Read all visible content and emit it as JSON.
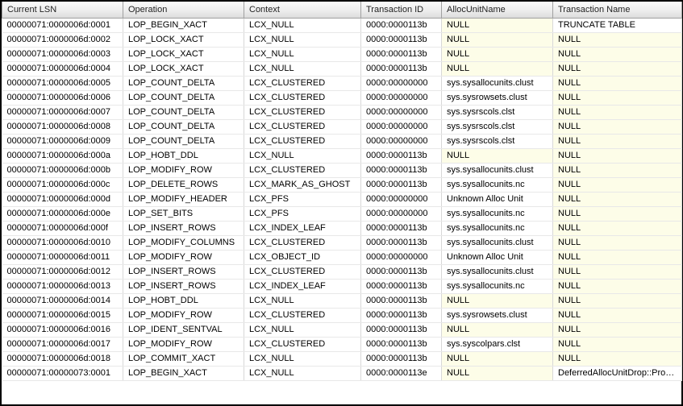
{
  "columns": [
    {
      "key": "lsn",
      "label": "Current LSN",
      "cls": "col-lsn"
    },
    {
      "key": "op",
      "label": "Operation",
      "cls": "col-op"
    },
    {
      "key": "ctx",
      "label": "Context",
      "cls": "col-ctx"
    },
    {
      "key": "tid",
      "label": "Transaction ID",
      "cls": "col-tid"
    },
    {
      "key": "alloc",
      "label": "AllocUnitName",
      "cls": "col-alloc"
    },
    {
      "key": "tname",
      "label": "Transaction Name",
      "cls": "col-tname"
    }
  ],
  "rows": [
    {
      "lsn": "00000071:0000006d:0001",
      "op": "LOP_BEGIN_XACT",
      "ctx": "LCX_NULL",
      "tid": "0000:0000113b",
      "alloc": "NULL",
      "tname": "TRUNCATE TABLE"
    },
    {
      "lsn": "00000071:0000006d:0002",
      "op": "LOP_LOCK_XACT",
      "ctx": "LCX_NULL",
      "tid": "0000:0000113b",
      "alloc": "NULL",
      "tname": "NULL"
    },
    {
      "lsn": "00000071:0000006d:0003",
      "op": "LOP_LOCK_XACT",
      "ctx": "LCX_NULL",
      "tid": "0000:0000113b",
      "alloc": "NULL",
      "tname": "NULL"
    },
    {
      "lsn": "00000071:0000006d:0004",
      "op": "LOP_LOCK_XACT",
      "ctx": "LCX_NULL",
      "tid": "0000:0000113b",
      "alloc": "NULL",
      "tname": "NULL"
    },
    {
      "lsn": "00000071:0000006d:0005",
      "op": "LOP_COUNT_DELTA",
      "ctx": "LCX_CLUSTERED",
      "tid": "0000:00000000",
      "alloc": "sys.sysallocunits.clust",
      "tname": "NULL"
    },
    {
      "lsn": "00000071:0000006d:0006",
      "op": "LOP_COUNT_DELTA",
      "ctx": "LCX_CLUSTERED",
      "tid": "0000:00000000",
      "alloc": "sys.sysrowsets.clust",
      "tname": "NULL"
    },
    {
      "lsn": "00000071:0000006d:0007",
      "op": "LOP_COUNT_DELTA",
      "ctx": "LCX_CLUSTERED",
      "tid": "0000:00000000",
      "alloc": "sys.sysrscols.clst",
      "tname": "NULL"
    },
    {
      "lsn": "00000071:0000006d:0008",
      "op": "LOP_COUNT_DELTA",
      "ctx": "LCX_CLUSTERED",
      "tid": "0000:00000000",
      "alloc": "sys.sysrscols.clst",
      "tname": "NULL"
    },
    {
      "lsn": "00000071:0000006d:0009",
      "op": "LOP_COUNT_DELTA",
      "ctx": "LCX_CLUSTERED",
      "tid": "0000:00000000",
      "alloc": "sys.sysrscols.clst",
      "tname": "NULL"
    },
    {
      "lsn": "00000071:0000006d:000a",
      "op": "LOP_HOBT_DDL",
      "ctx": "LCX_NULL",
      "tid": "0000:0000113b",
      "alloc": "NULL",
      "tname": "NULL"
    },
    {
      "lsn": "00000071:0000006d:000b",
      "op": "LOP_MODIFY_ROW",
      "ctx": "LCX_CLUSTERED",
      "tid": "0000:0000113b",
      "alloc": "sys.sysallocunits.clust",
      "tname": "NULL"
    },
    {
      "lsn": "00000071:0000006d:000c",
      "op": "LOP_DELETE_ROWS",
      "ctx": "LCX_MARK_AS_GHOST",
      "tid": "0000:0000113b",
      "alloc": "sys.sysallocunits.nc",
      "tname": "NULL"
    },
    {
      "lsn": "00000071:0000006d:000d",
      "op": "LOP_MODIFY_HEADER",
      "ctx": "LCX_PFS",
      "tid": "0000:00000000",
      "alloc": "Unknown Alloc Unit",
      "tname": "NULL"
    },
    {
      "lsn": "00000071:0000006d:000e",
      "op": "LOP_SET_BITS",
      "ctx": "LCX_PFS",
      "tid": "0000:00000000",
      "alloc": "sys.sysallocunits.nc",
      "tname": "NULL"
    },
    {
      "lsn": "00000071:0000006d:000f",
      "op": "LOP_INSERT_ROWS",
      "ctx": "LCX_INDEX_LEAF",
      "tid": "0000:0000113b",
      "alloc": "sys.sysallocunits.nc",
      "tname": "NULL"
    },
    {
      "lsn": "00000071:0000006d:0010",
      "op": "LOP_MODIFY_COLUMNS",
      "ctx": "LCX_CLUSTERED",
      "tid": "0000:0000113b",
      "alloc": "sys.sysallocunits.clust",
      "tname": "NULL"
    },
    {
      "lsn": "00000071:0000006d:0011",
      "op": "LOP_MODIFY_ROW",
      "ctx": "LCX_OBJECT_ID",
      "tid": "0000:00000000",
      "alloc": "Unknown Alloc Unit",
      "tname": "NULL"
    },
    {
      "lsn": "00000071:0000006d:0012",
      "op": "LOP_INSERT_ROWS",
      "ctx": "LCX_CLUSTERED",
      "tid": "0000:0000113b",
      "alloc": "sys.sysallocunits.clust",
      "tname": "NULL"
    },
    {
      "lsn": "00000071:0000006d:0013",
      "op": "LOP_INSERT_ROWS",
      "ctx": "LCX_INDEX_LEAF",
      "tid": "0000:0000113b",
      "alloc": "sys.sysallocunits.nc",
      "tname": "NULL"
    },
    {
      "lsn": "00000071:0000006d:0014",
      "op": "LOP_HOBT_DDL",
      "ctx": "LCX_NULL",
      "tid": "0000:0000113b",
      "alloc": "NULL",
      "tname": "NULL"
    },
    {
      "lsn": "00000071:0000006d:0015",
      "op": "LOP_MODIFY_ROW",
      "ctx": "LCX_CLUSTERED",
      "tid": "0000:0000113b",
      "alloc": "sys.sysrowsets.clust",
      "tname": "NULL"
    },
    {
      "lsn": "00000071:0000006d:0016",
      "op": "LOP_IDENT_SENTVAL",
      "ctx": "LCX_NULL",
      "tid": "0000:0000113b",
      "alloc": "NULL",
      "tname": "NULL"
    },
    {
      "lsn": "00000071:0000006d:0017",
      "op": "LOP_MODIFY_ROW",
      "ctx": "LCX_CLUSTERED",
      "tid": "0000:0000113b",
      "alloc": "sys.syscolpars.clst",
      "tname": "NULL"
    },
    {
      "lsn": "00000071:0000006d:0018",
      "op": "LOP_COMMIT_XACT",
      "ctx": "LCX_NULL",
      "tid": "0000:0000113b",
      "alloc": "NULL",
      "tname": "NULL"
    },
    {
      "lsn": "00000071:00000073:0001",
      "op": "LOP_BEGIN_XACT",
      "ctx": "LCX_NULL",
      "tid": "0000:0000113e",
      "alloc": "NULL",
      "tname": "DeferredAllocUnitDrop::Proc..."
    }
  ]
}
